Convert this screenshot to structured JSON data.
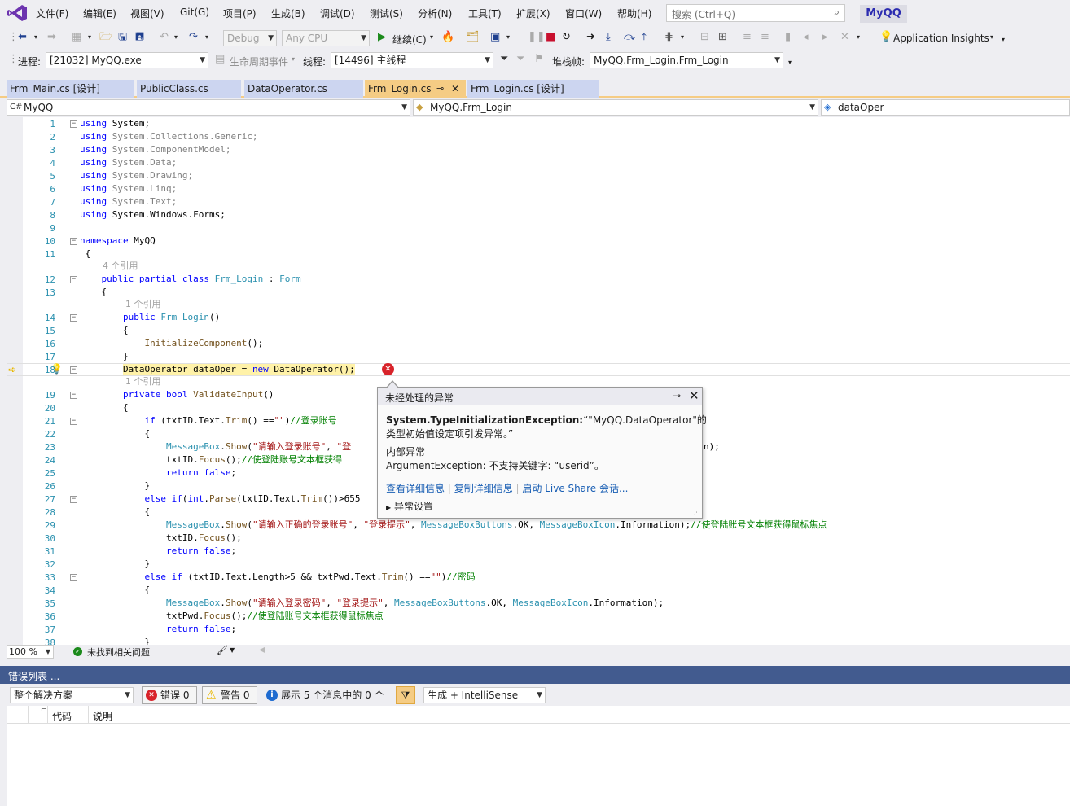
{
  "menu": {
    "items": [
      "文件(F)",
      "编辑(E)",
      "视图(V)",
      "Git(G)",
      "项目(P)",
      "生成(B)",
      "调试(D)",
      "测试(S)",
      "分析(N)",
      "工具(T)",
      "扩展(X)",
      "窗口(W)",
      "帮助(H)"
    ],
    "search_placeholder": "搜索 (Ctrl+Q)",
    "app_title": "MyQQ"
  },
  "toolbar1": {
    "config": "Debug",
    "platform": "Any CPU",
    "continue_label": "继续(C)",
    "app_insights": "Application Insights"
  },
  "toolbar2": {
    "process_label": "进程:",
    "process_value": "[21032] MyQQ.exe",
    "lifecycle_label": "生命周期事件",
    "thread_label": "线程:",
    "thread_value": "[14496] 主线程",
    "stack_label": "堆栈帧:",
    "stack_value": "MyQQ.Frm_Login.Frm_Login"
  },
  "tabs": [
    {
      "label": "Frm_Main.cs [设计]"
    },
    {
      "label": "PublicClass.cs"
    },
    {
      "label": "DataOperator.cs"
    },
    {
      "label": "Frm_Login.cs"
    },
    {
      "label": "Frm_Login.cs [设计]"
    }
  ],
  "navbar": {
    "project": "MyQQ",
    "class": "MyQQ.Frm_Login",
    "member": "dataOper"
  },
  "code": {
    "l1": "System;",
    "l2": "System.Collections.Generic;",
    "l3": "System.ComponentModel;",
    "l4": "System.Data;",
    "l5": "System.Drawing;",
    "l6": "System.Linq;",
    "l7": "System.Text;",
    "l8": "System.Windows.Forms;",
    "ref4": "4 个引用",
    "ref1": "1 个引用",
    "cm21": "//登录账号",
    "str21": "\"\"",
    "str23a": "\"请输入登录账号\"",
    "str23b": "\"登",
    "cm24": "//使登陆账号文本框获得",
    "str29a": "\"请输入正确的登录账号\"",
    "str29b": "\"登录提示\"",
    "cm29": "//使登陆账号文本框获得鼠标焦点",
    "cm33": "//密码",
    "str35a": "\"请输入登录密码\"",
    "str35b": "\"登录提示\"",
    "cm36": "//使登陆账号文本框获得鼠标焦点"
  },
  "exception": {
    "title": "未经处理的异常",
    "type": "System.TypeInitializationException:",
    "message1": "“\"MyQQ.DataOperator\"的",
    "message2": "类型初始值设定项引发异常。”",
    "inner_label": "内部异常",
    "inner_message": "ArgumentException: 不支持关键字: “userid”。",
    "link_details": "查看详细信息",
    "link_copy": "复制详细信息",
    "link_liveshare": "启动 Live Share 会话...",
    "settings": "异常设置"
  },
  "status": {
    "zoom": "100 %",
    "issues": "未找到相关问题"
  },
  "error_list": {
    "title": "错误列表 ...",
    "scope": "整个解决方案",
    "errors": "错误 0",
    "warnings": "警告 0",
    "messages": "展示 5 个消息中的 0 个",
    "source": "生成 + IntelliSense",
    "col_code": "代码",
    "col_desc": "说明"
  }
}
